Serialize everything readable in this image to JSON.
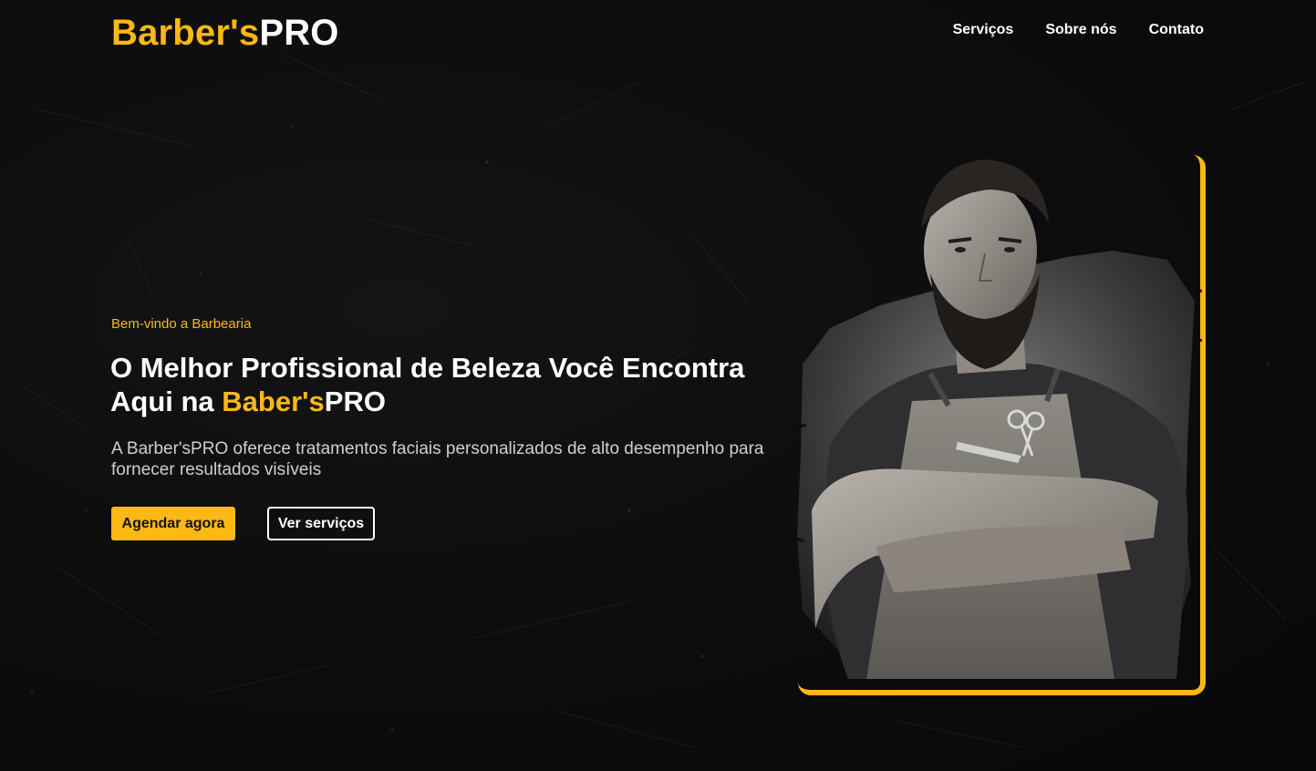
{
  "header": {
    "logo_part1": "Barber's",
    "logo_part2": "PRO",
    "nav": [
      {
        "label": "Serviços"
      },
      {
        "label": "Sobre nós"
      },
      {
        "label": "Contato"
      }
    ]
  },
  "hero": {
    "kicker": "Bem-vindo a Barbearia",
    "headline_line1": "O Melhor Profissional de Beleza Você Encontra",
    "headline_prefix": "Aqui na ",
    "headline_accent": "Baber's",
    "headline_suffix": "PRO",
    "lead": "A Barber'sPRO oferece tratamentos faciais personalizados de alto desempenho para fornecer resultados visíveis",
    "primary_cta": "Agendar agora",
    "secondary_cta": "Ver serviços",
    "image_icon": "barber-photo-icon"
  },
  "colors": {
    "accent": "#fdb813",
    "background": "#0b0b0c",
    "text": "#ffffff",
    "muted_text": "#cfcfcf"
  }
}
